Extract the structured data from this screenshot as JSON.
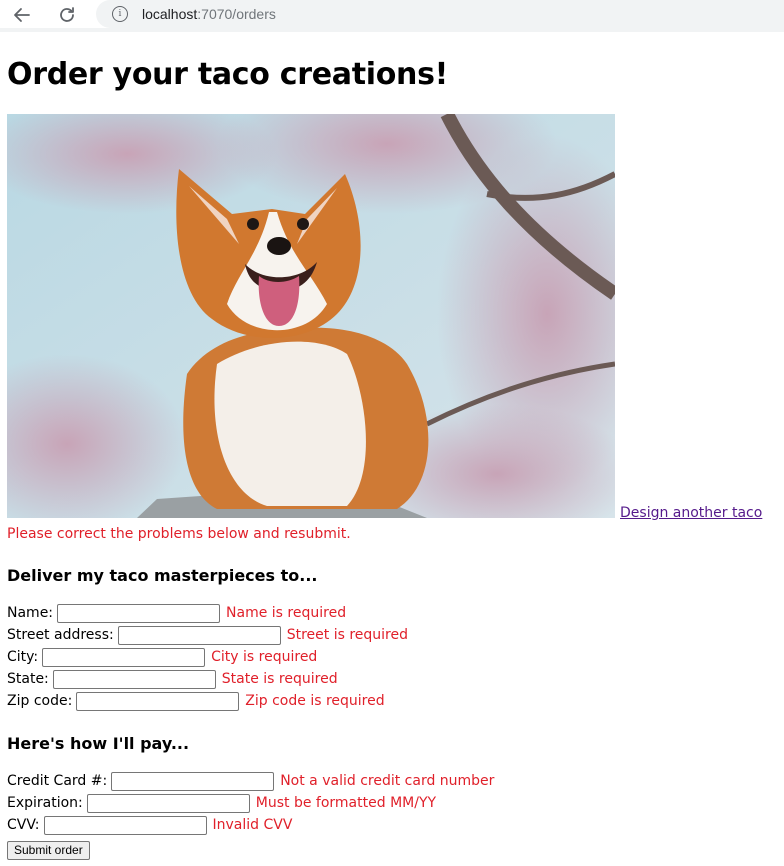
{
  "browser": {
    "url_host": "localhost",
    "url_path": ":7070/orders",
    "info_glyph": "i"
  },
  "page": {
    "title": "Order your taco creations!",
    "design_link": "Design another taco",
    "error_banner": "Please correct the problems below and resubmit."
  },
  "deliver": {
    "heading": "Deliver my taco masterpieces to...",
    "fields": [
      {
        "label": "Name:",
        "value": "",
        "error": "Name is required"
      },
      {
        "label": "Street address:",
        "value": "",
        "error": "Street is required"
      },
      {
        "label": "City:",
        "value": "",
        "error": "City is required"
      },
      {
        "label": "State:",
        "value": "",
        "error": "State is required"
      },
      {
        "label": "Zip code:",
        "value": "",
        "error": "Zip code is required"
      }
    ]
  },
  "pay": {
    "heading": "Here's how I'll pay...",
    "fields": [
      {
        "label": "Credit Card #:",
        "value": "",
        "error": "Not a valid credit card number"
      },
      {
        "label": "Expiration:",
        "value": "",
        "error": "Must be formatted MM/YY"
      },
      {
        "label": "CVV:",
        "value": "",
        "error": "Invalid CVV"
      }
    ]
  },
  "submit_label": "Submit order",
  "colors": {
    "error": "#e0202a",
    "link_visited": "#551a8b"
  },
  "icons": {
    "back": "back-arrow-icon",
    "reload": "reload-icon",
    "info": "info-icon"
  }
}
